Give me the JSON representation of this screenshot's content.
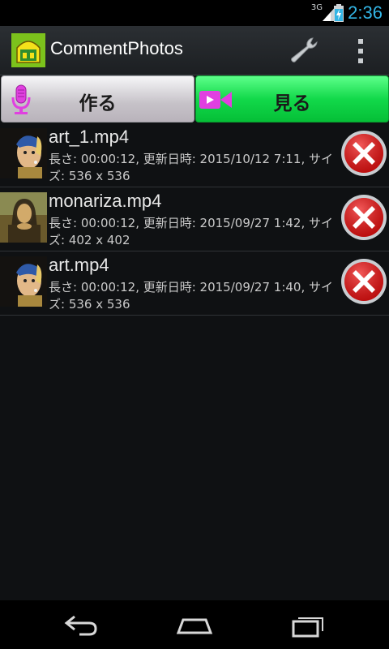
{
  "status_bar": {
    "network": "3G",
    "time": "2:36"
  },
  "action_bar": {
    "title": "CommentPhotos",
    "settings_icon": "wrench-icon",
    "overflow_icon": "overflow-menu-icon"
  },
  "tabs": [
    {
      "label": "作る",
      "icon": "microphone-icon",
      "selected": false
    },
    {
      "label": "見る",
      "icon": "video-camera-icon",
      "selected": true
    }
  ],
  "files": [
    {
      "name": "art_1.mp4",
      "meta": "長さ: 00:00:12, 更新日時: 2015/10/12 7:11, サイズ: 536 x 536",
      "thumbnail": "girl-with-pearl-earring"
    },
    {
      "name": "monariza.mp4",
      "meta": "長さ: 00:00:12, 更新日時: 2015/09/27 1:42, サイズ: 402 x 402",
      "thumbnail": "mona-lisa"
    },
    {
      "name": "art.mp4",
      "meta": "長さ: 00:00:12, 更新日時: 2015/09/27 1:40, サイズ: 536 x 536",
      "thumbnail": "girl-with-pearl-earring"
    }
  ],
  "colors": {
    "clock": "#33b5e5",
    "view_tab": "#12d94a",
    "make_tab": "#d8d4da",
    "accent_icon": "#e040e0",
    "delete": "#d81010"
  },
  "nav": {
    "back": "back-icon",
    "home": "home-icon",
    "recents": "recent-apps-icon"
  }
}
